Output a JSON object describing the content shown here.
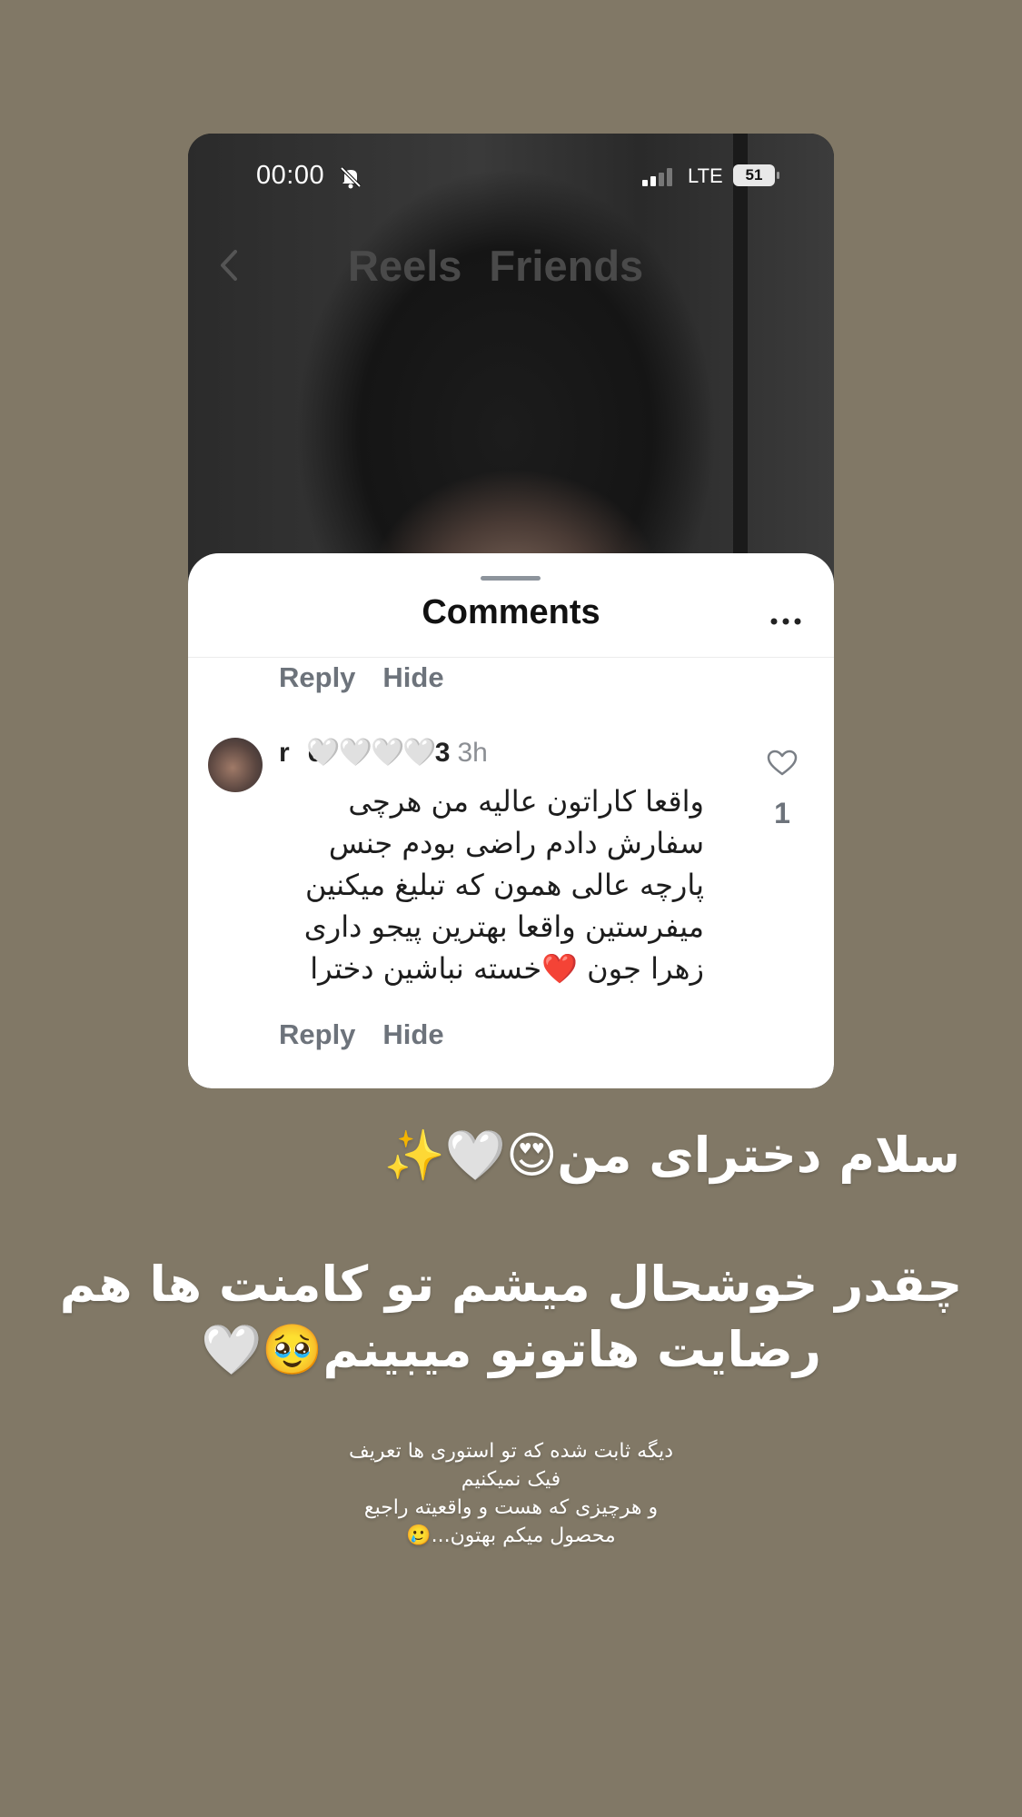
{
  "status_bar": {
    "time": "00:00",
    "network": "LTE",
    "battery": "51",
    "icons": [
      "bell-slash-icon",
      "signal-icon",
      "battery-icon"
    ]
  },
  "reels_header": {
    "tabs": [
      "Reels",
      "Friends"
    ],
    "back_icon": "chevron-left-icon"
  },
  "comments_sheet": {
    "title": "Comments",
    "more_icon": "ellipsis-icon",
    "prev_actions": {
      "reply": "Reply",
      "hide": "Hide"
    },
    "comment": {
      "username": "r",
      "username_mid": "e",
      "username_end": "3",
      "hearts": "🤍🤍🤍🤍",
      "time_ago": "3h",
      "lines": [
        "واقعا کاراتون عالیه من هرچی",
        "سفارش دادم راضی بودم جنس",
        "پارچه عالی همون که تبلیغ میکنین",
        "میفرستین واقعا بهترین پیجو داری",
        "زهرا جون ❤️خسته نباشین دخترا"
      ],
      "like_count": "1",
      "actions": {
        "reply": "Reply",
        "hide": "Hide"
      }
    }
  },
  "story_text": {
    "greeting": "سلام دخترای من😍🤍✨",
    "happy_line1": "چقدر خوشحال میشم تو کامنت ها هم",
    "happy_line2": "رضایت هاتونو میبینم🥹🤍",
    "note_line1": "دیگه ثابت شده که تو استوری ها تعریف",
    "note_line2": "فیک نمیکنیم",
    "note_line3": "و هرچیزی که هست و واقعیته راجبع",
    "note_line4": "محصول میکم بهتون...🥲"
  },
  "colors": {
    "background": "#817866",
    "sheet": "#ffffff",
    "muted_text": "#6d737b"
  }
}
